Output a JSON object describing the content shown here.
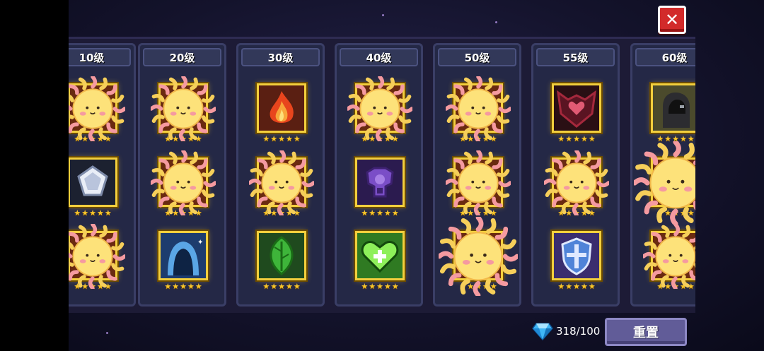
{
  "header": {
    "close_label": "✕"
  },
  "columns": [
    {
      "level": "10级",
      "talents": [
        {
          "icon": "sun-sticker-icon",
          "stars": 5
        },
        {
          "icon": "crystal-icon",
          "stars": 5
        },
        {
          "icon": "sun-sticker-icon",
          "stars": 5
        }
      ]
    },
    {
      "level": "20级",
      "talents": [
        {
          "icon": "sun-sticker-icon",
          "stars": 5
        },
        {
          "icon": "sun-sticker-icon",
          "stars": 5
        },
        {
          "icon": "shadow-figure-icon",
          "stars": 5
        }
      ]
    },
    {
      "level": "30级",
      "talents": [
        {
          "icon": "flame-icon",
          "stars": 5
        },
        {
          "icon": "sun-sticker-icon",
          "stars": 5
        },
        {
          "icon": "leaf-icon",
          "stars": 5
        }
      ]
    },
    {
      "level": "40级",
      "talents": [
        {
          "icon": "sun-sticker-icon",
          "stars": 5
        },
        {
          "icon": "purple-armor-icon",
          "stars": 5
        },
        {
          "icon": "green-heart-icon",
          "stars": 5
        }
      ]
    },
    {
      "level": "50级",
      "talents": [
        {
          "icon": "sun-sticker-icon",
          "stars": 5
        },
        {
          "icon": "sun-sticker-icon",
          "stars": 5
        },
        {
          "icon": "sun-sticker-icon",
          "stars": 5
        }
      ]
    },
    {
      "level": "55级",
      "talents": [
        {
          "icon": "dark-heart-icon",
          "stars": 5
        },
        {
          "icon": "sun-sticker-icon",
          "stars": 5
        },
        {
          "icon": "blue-shield-icon",
          "stars": 5
        }
      ]
    },
    {
      "level": "60级",
      "talents": [
        {
          "icon": "hooded-figure-icon",
          "stars": 5
        },
        {
          "icon": "sun-sticker-icon",
          "stars": 5
        },
        {
          "icon": "sun-sticker-icon",
          "stars": 5
        }
      ]
    }
  ],
  "footer": {
    "gem_icon": "diamond-icon",
    "gem_count": "318/100",
    "reset_label": "重置"
  },
  "colors": {
    "frame_gold": "#f3cf3d",
    "close_red": "#d22a2a",
    "reset_purple": "#615c98",
    "star_gold": "#f7c62c"
  }
}
